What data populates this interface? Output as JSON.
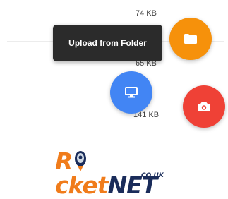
{
  "files": [
    {
      "size": "74 KB"
    },
    {
      "size": "65 KB"
    },
    {
      "size": "141 KB"
    }
  ],
  "tooltip": {
    "text": "Upload from Folder"
  },
  "fabs": {
    "folder": {
      "icon": "folder-icon",
      "color": "#f6910b"
    },
    "desktop": {
      "icon": "desktop-icon",
      "color": "#4285f4"
    },
    "camera": {
      "icon": "camera-icon",
      "color": "#ef4136"
    }
  },
  "logo": {
    "part1": "R",
    "part2": "cket",
    "part3": "NET",
    "sub": "CO.UK"
  }
}
